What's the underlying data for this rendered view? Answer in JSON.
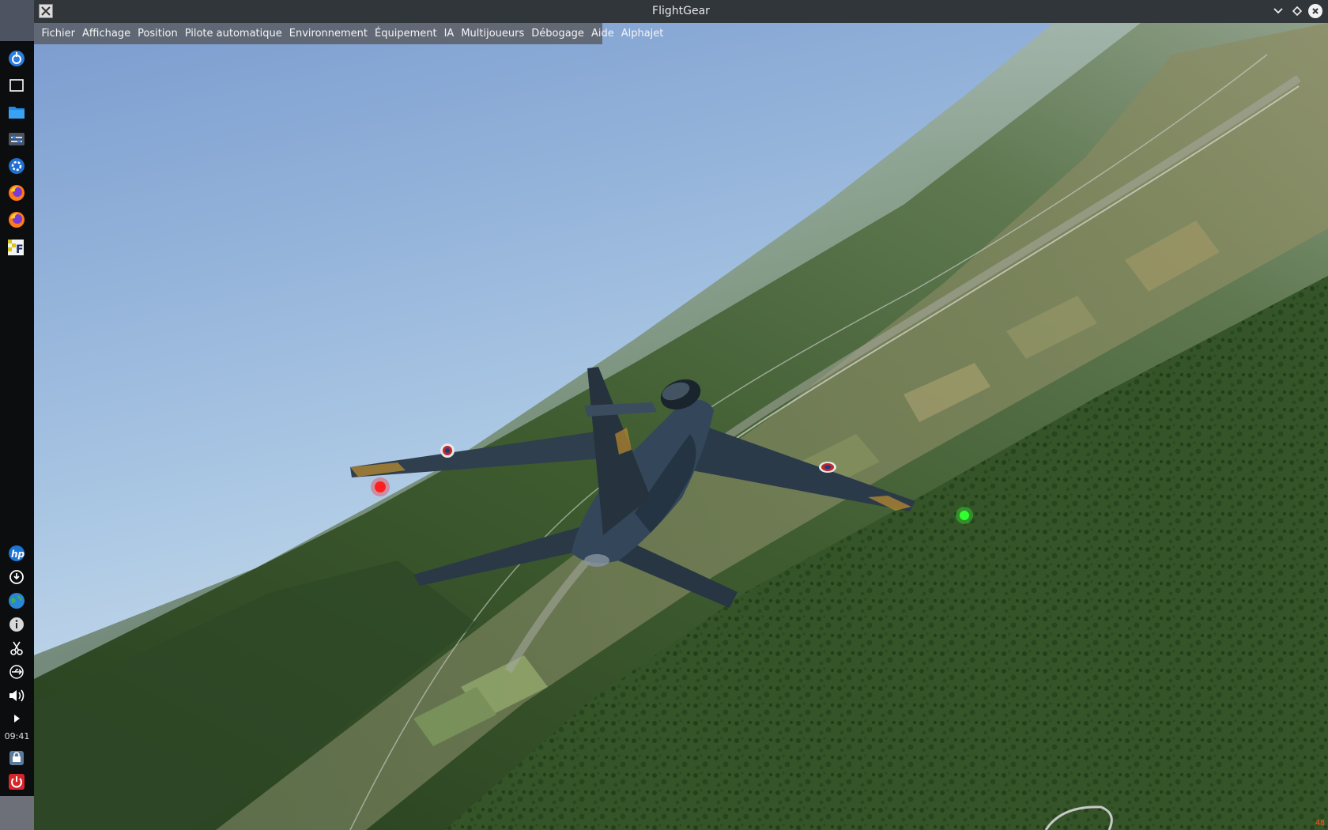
{
  "window": {
    "title": "FlightGear",
    "app_icon": "x-icon"
  },
  "menu": {
    "items": [
      "Fichier",
      "Affichage",
      "Position",
      "Pilote automatique",
      "Environnement",
      "Équipement",
      "IA",
      "Multijoueurs",
      "Débogage",
      "Aide",
      "Alphajet"
    ]
  },
  "dock": {
    "clock": "09:41",
    "top_icons": [
      "launcher-icon",
      "desktop-icon",
      "file-manager-icon",
      "system-settings-icon",
      "control-center-icon",
      "firefox-icon",
      "firefox-icon",
      "flightgear-icon"
    ],
    "bottom_icons": [
      "hp-icon",
      "updater-icon",
      "network-globe-icon",
      "info-icon",
      "scissors-icon",
      "usb-icon",
      "volume-icon",
      "expand-arrow-icon",
      "lock-screen-icon",
      "power-icon"
    ]
  },
  "scene": {
    "sky_top": "#7d9fd0",
    "sky_horizon": "#cfe3ef",
    "ground": "#3c5a2e",
    "aircraft_color": "#2b3a48",
    "nav_light_left": "#ff2020",
    "nav_light_right": "#30ff30"
  },
  "hud": {
    "fps": "48"
  }
}
